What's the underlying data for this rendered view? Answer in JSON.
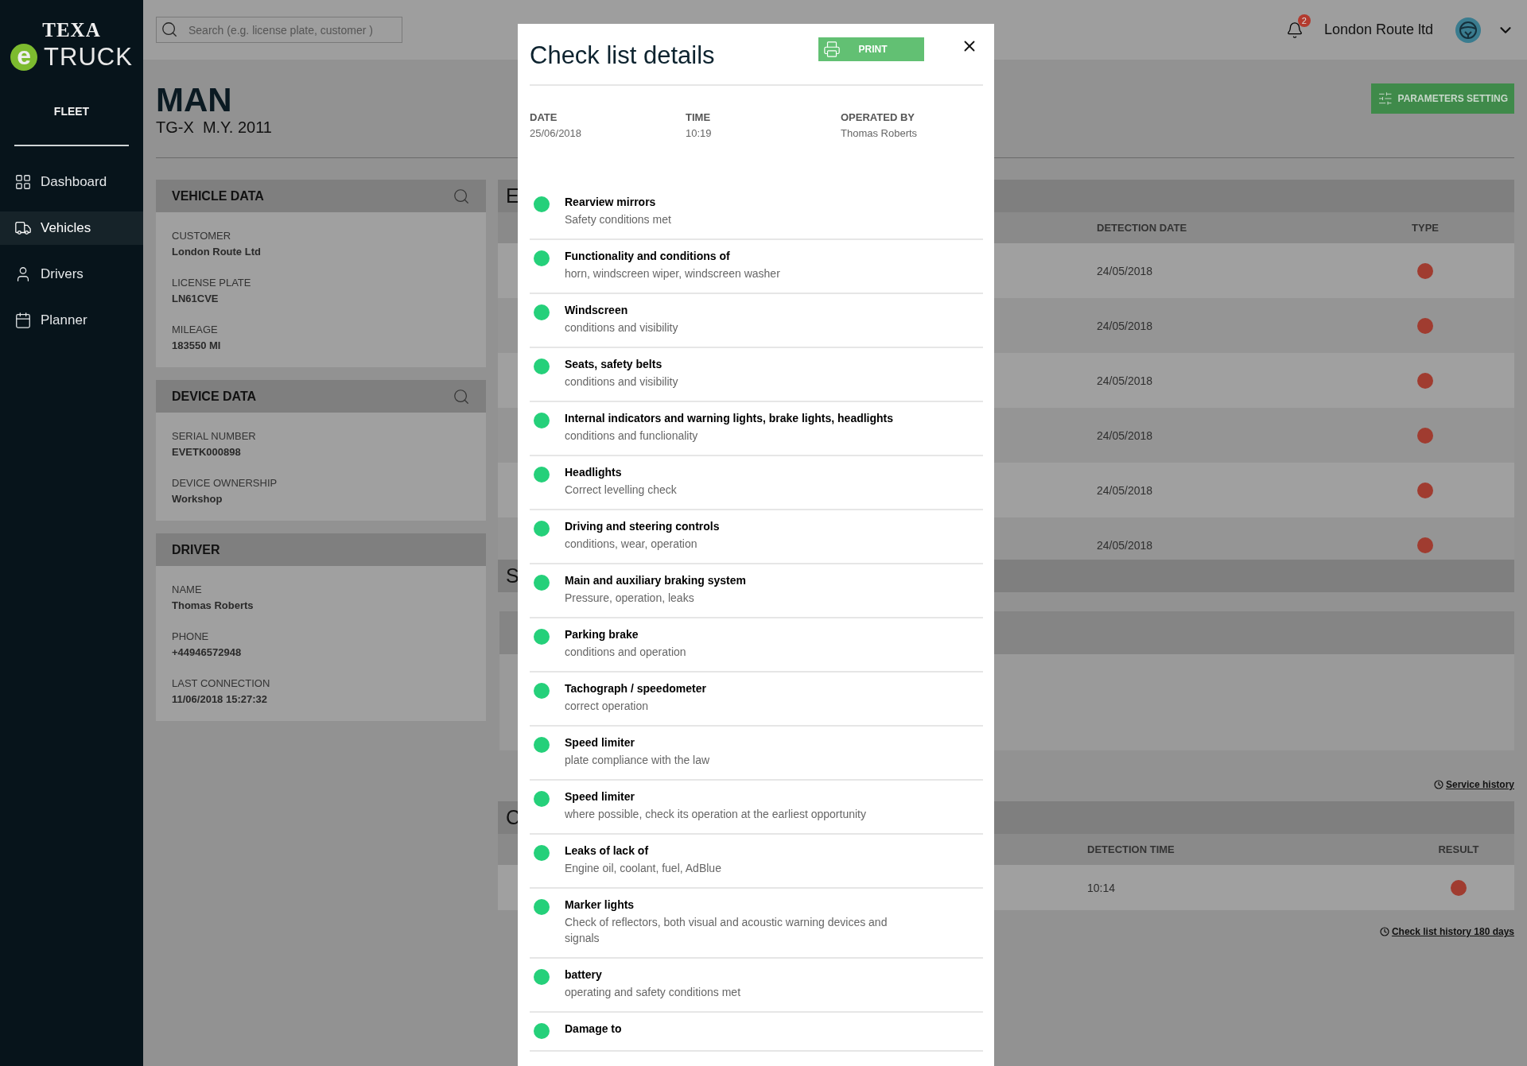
{
  "sidebar": {
    "logo": {
      "top": "TEXA",
      "badge": "e",
      "word": "TRUCK"
    },
    "section": "FLEET",
    "items": [
      {
        "label": "Dashboard",
        "selected": false
      },
      {
        "label": "Vehicles",
        "selected": true
      },
      {
        "label": "Drivers",
        "selected": false
      },
      {
        "label": "Planner",
        "selected": false
      }
    ]
  },
  "topbar": {
    "search": {
      "placeholder": "Search (e.g. license plate, customer )"
    },
    "notifications": "2",
    "account": "London Route ltd"
  },
  "vehicle": {
    "make": "MAN",
    "model": "TG-X  M.Y. 2011"
  },
  "parameters_button": "PARAMETERS SETTING",
  "panels": [
    {
      "title": "VEHICLE DATA",
      "searchable": true,
      "fields": [
        {
          "label": "CUSTOMER",
          "value": "London Route Ltd"
        },
        {
          "label": "LICENSE PLATE",
          "value": "LN61CVE"
        },
        {
          "label": "MILEAGE",
          "value": "183550 MI"
        }
      ]
    },
    {
      "title": "DEVICE DATA",
      "searchable": true,
      "fields": [
        {
          "label": "SERIAL NUMBER",
          "value": "EVETK000898"
        },
        {
          "label": "DEVICE OWNERSHIP",
          "value": "Workshop"
        }
      ]
    },
    {
      "title": "DRIVER",
      "searchable": false,
      "fields": [
        {
          "label": "NAME",
          "value": "Thomas Roberts"
        },
        {
          "label": "PHONE",
          "value": "+44946572948"
        },
        {
          "label": "LAST CONNECTION",
          "value": "11/06/2018 15:27:32"
        }
      ]
    }
  ],
  "events_panel": {
    "title": "E",
    "columns": [
      "DETECTION DATE",
      "TYPE"
    ],
    "rows": [
      {
        "detection_date": "24/05/2018",
        "color": "#a03c30"
      },
      {
        "detection_date": "24/05/2018",
        "color": "#a03c30"
      },
      {
        "detection_date": "24/05/2018",
        "color": "#a03c30"
      },
      {
        "detection_date": "24/05/2018",
        "color": "#a03c30"
      },
      {
        "detection_date": "24/05/2018",
        "color": "#a03c30"
      },
      {
        "detection_date": "24/05/2018",
        "color": "#a03c30"
      }
    ]
  },
  "service_panel": {
    "title": "S",
    "history_link": "Service history"
  },
  "checklist_panel": {
    "title": "C",
    "columns": [
      "DETECTION TIME",
      "RESULT"
    ],
    "rows": [
      {
        "detection_time": "10:14",
        "color": "#a03c30"
      }
    ],
    "history_link": "Check list history 180 days"
  },
  "modal": {
    "title": "Check list details",
    "print_button": "PRINT",
    "meta": [
      {
        "label": "DATE",
        "value": "25/06/2018"
      },
      {
        "label": "TIME",
        "value": "10:19"
      },
      {
        "label": "OPERATED BY",
        "value": "Thomas Roberts"
      }
    ],
    "items": [
      {
        "title": "Rearview mirrors",
        "detail": "Safety conditions met",
        "passed": true
      },
      {
        "title": "Functionality and conditions of",
        "detail": "horn, windscreen wiper, windscreen washer",
        "passed": true
      },
      {
        "title": "Windscreen",
        "detail": "conditions and visibility",
        "passed": true
      },
      {
        "title": "Seats, safety belts",
        "detail": "conditions and visibility",
        "passed": true
      },
      {
        "title": "Internal indicators and warning lights, brake lights, headlights",
        "detail": "conditions and funclionality",
        "passed": true
      },
      {
        "title": "Headlights",
        "detail": "Correct levelling check",
        "passed": true
      },
      {
        "title": "Driving and steering controls",
        "detail": "conditions, wear, operation",
        "passed": true
      },
      {
        "title": "Main and auxiliary braking system",
        "detail": "Pressure, operation, leaks",
        "passed": true
      },
      {
        "title": "Parking brake",
        "detail": "conditions and operation",
        "passed": true
      },
      {
        "title": "Tachograph / speedometer",
        "detail": "correct operation",
        "passed": true
      },
      {
        "title": "Speed limiter",
        "detail": "plate compliance with the law",
        "passed": true
      },
      {
        "title": "Speed limiter",
        "detail": "where possible, check its operation at the earliest opportunity",
        "passed": true
      },
      {
        "title": "Leaks of lack of",
        "detail": "Engine oil, coolant, fuel, AdBlue",
        "passed": true
      },
      {
        "title": "Marker lights",
        "detail": "Check of reflectors, both visual and acoustic warning devices and signals",
        "passed": true
      },
      {
        "title": "battery",
        "detail": "operating and safety conditions met",
        "passed": true
      },
      {
        "title": "Damage to",
        "passed": true
      }
    ]
  }
}
